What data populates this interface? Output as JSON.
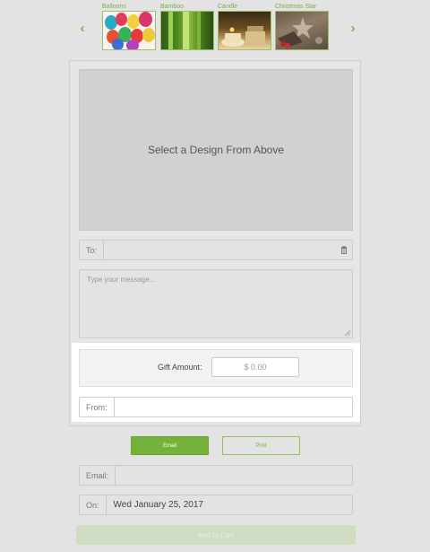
{
  "carousel": {
    "prev_icon": "chevron-left-icon",
    "next_icon": "chevron-right-icon",
    "prev_glyph": "‹",
    "next_glyph": "›",
    "designs": [
      {
        "label": "Balloons"
      },
      {
        "label": "Bamboo"
      },
      {
        "label": "Candle"
      },
      {
        "label": "Christmas Star"
      }
    ]
  },
  "preview": {
    "text": "Select a Design From Above"
  },
  "to_field": {
    "label": "To:",
    "value": "",
    "icon": "trash-icon"
  },
  "message": {
    "placeholder": "Type your message..."
  },
  "gift_amount": {
    "label": "Gift Amount:",
    "placeholder": "$ 0.00"
  },
  "from_field": {
    "label": "From:",
    "value": ""
  },
  "delivery": {
    "email_label": "Email",
    "print_label": "Print"
  },
  "email_field": {
    "label": "Email:",
    "value": ""
  },
  "on_field": {
    "label": "On:",
    "value": "Wed January 25, 2017"
  },
  "cart": {
    "label": "Add to Cart"
  },
  "colors": {
    "accent": "#75b23a",
    "highlight": "#ffffff",
    "background": "#e3e3e3"
  }
}
